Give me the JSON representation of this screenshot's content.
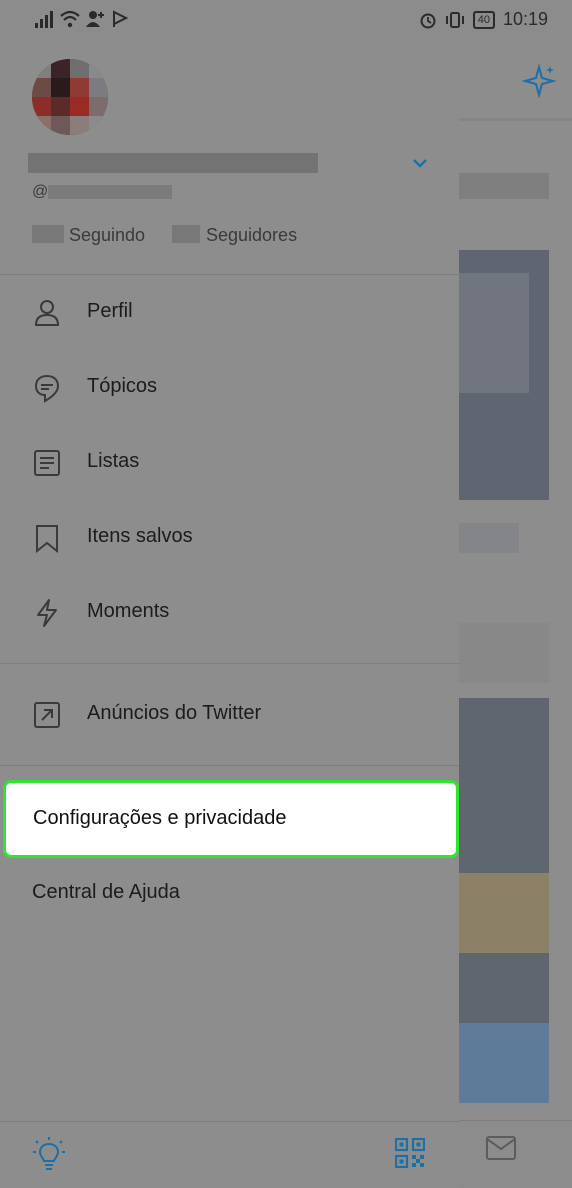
{
  "status_bar": {
    "battery": "40",
    "time": "10:19"
  },
  "profile": {
    "handle_prefix": "@",
    "following_label": "Seguindo",
    "followers_label": "Seguidores"
  },
  "menu": [
    {
      "label": "Perfil",
      "icon": "person-icon"
    },
    {
      "label": "Tópicos",
      "icon": "topics-icon"
    },
    {
      "label": "Listas",
      "icon": "lists-icon"
    },
    {
      "label": "Itens salvos",
      "icon": "bookmark-icon"
    },
    {
      "label": "Moments",
      "icon": "lightning-icon"
    }
  ],
  "ads": {
    "label": "Anúncios do Twitter",
    "icon": "external-arrow-icon"
  },
  "settings": {
    "label": "Configurações e privacidade"
  },
  "help": {
    "label": "Central de Ajuda"
  },
  "colors": {
    "accent": "#1d6fa5",
    "highlight_border": "#2fe62f"
  }
}
